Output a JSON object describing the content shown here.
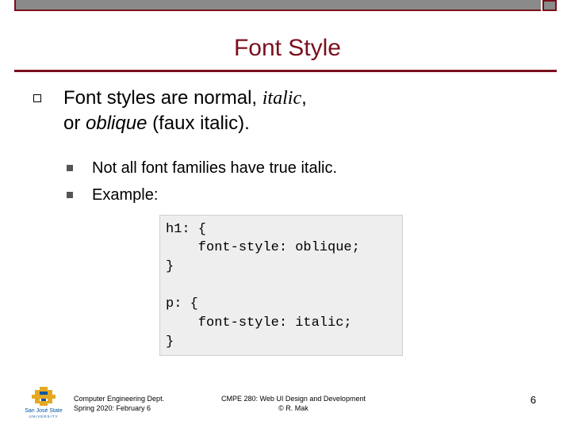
{
  "slide": {
    "title": "Font Style",
    "bullet": {
      "line1_prefix": "Font styles are normal, ",
      "line1_italic": "italic",
      "line1_suffix": ",",
      "line2_prefix": "or ",
      "line2_oblique": "oblique",
      "line2_suffix": " (faux italic)."
    },
    "sub_bullets": [
      "Not all font families have true italic.",
      "Example:"
    ],
    "code": {
      "line1": "h1: {",
      "line2": "    font-style: oblique;",
      "line3": "}",
      "line4": "p: {",
      "line5": "    font-style: italic;",
      "line6": "}"
    }
  },
  "footer": {
    "logo_text_top": "San José State",
    "logo_text_bottom": "UNIVERSITY",
    "left_line1": "Computer Engineering Dept.",
    "left_line2": "Spring 2020: February 6",
    "center_line1": "CMPE 280: Web UI Design and Development",
    "center_line2": "© R. Mak",
    "page_number": "6"
  },
  "colors": {
    "accent": "#7a0f1c",
    "bar": "#8a8a8a",
    "code_bg": "#eeeeee",
    "logo_gold": "#e5a823",
    "logo_blue": "#0055a2"
  }
}
